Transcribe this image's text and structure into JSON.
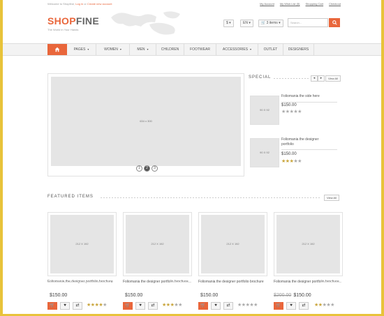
{
  "topbar": {
    "welcome": "Welcome to Shopfine,",
    "login_link": "Log in",
    "or": "or",
    "create_link": "Create new account",
    "links": [
      "My Account",
      "My Wish List (5)",
      "Shopping Cart",
      "Checkout"
    ]
  },
  "header": {
    "logo_shop": "SHOP",
    "logo_fine": "FINE",
    "tagline": "The World in Your Hands",
    "currency": "$ ▾",
    "language": "EN ▾",
    "cart": "🛒 3 items ▾",
    "search_placeholder": "Search...",
    "search_icon": "search-icon"
  },
  "nav": {
    "home_icon": "home-icon",
    "items": [
      "PAGES",
      "WOMEN",
      "MEN",
      "CHILDREN",
      "FOOTWEAR",
      "ACCESSORIES",
      "OUTLET",
      "DESIGNERS"
    ]
  },
  "slider": {
    "placeholder": "634 x 300",
    "dots": [
      "1",
      "2",
      "3"
    ],
    "active_dot": 2
  },
  "special": {
    "title": "SPECIAL",
    "view_all": "View All",
    "prev": "◂",
    "next": "▸",
    "products": [
      {
        "image": "90 X 92",
        "name": "Foliomania the side here",
        "price": "$150.00",
        "rating": 0
      },
      {
        "image": "90 X 92",
        "name": "Foliomania the designer portfolio",
        "price": "$150.00",
        "rating": 3
      }
    ]
  },
  "featured": {
    "title": "FEATURED ITEMS",
    "view_all": "View All",
    "products": [
      {
        "image": "212 X 192",
        "name": "Foliomania the designer portfolio brochure",
        "old_price": "",
        "price": "$150.00",
        "rating": 4
      },
      {
        "image": "212 X 192",
        "name": "Foliomania the designer portfolio brochure",
        "old_price": "",
        "price": "$150.00",
        "rating": 3
      },
      {
        "image": "212 X 192",
        "name": "Foliomania the designer portfolio brochure",
        "old_price": "",
        "price": "$150.00",
        "rating": 0
      },
      {
        "image": "212 X 192",
        "name": "Foliomania the designer portfolio brochure",
        "old_price": "$200.00",
        "price": "$150.00",
        "rating": 2
      }
    ],
    "buttons": {
      "cart": "🛒",
      "wish": "♥",
      "compare": "⇄"
    }
  },
  "colors": {
    "accent": "#e9663b",
    "star": "#c9a53b",
    "frame": "#e8c33a"
  }
}
